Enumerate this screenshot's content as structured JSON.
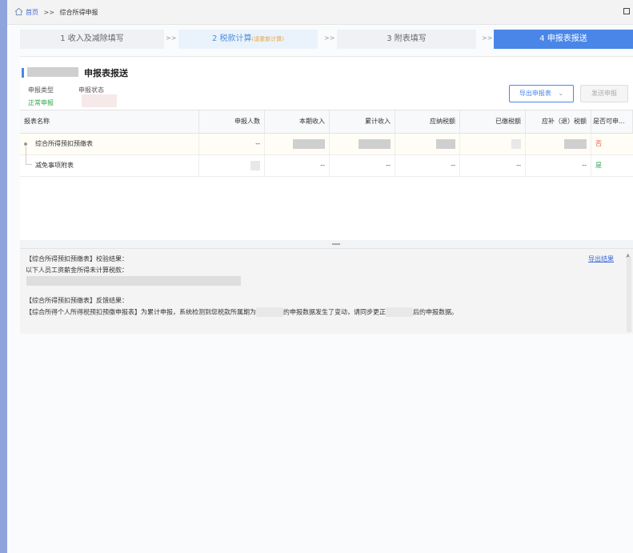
{
  "breadcrumb": {
    "home": "首页",
    "separator": ">>",
    "current": "综合所得申报"
  },
  "steps": [
    {
      "label": "1 收入及减除填写",
      "hint": ""
    },
    {
      "label": "2 税款计算",
      "hint": "(请重新计算)"
    },
    {
      "label": "3 附表填写",
      "hint": ""
    },
    {
      "label": "4 申报表报送",
      "hint": ""
    }
  ],
  "step_arrow": ">>",
  "panel": {
    "title": "申报表报送",
    "type_label": "申报类型",
    "type_value": "正常申报",
    "status_label": "申报状态",
    "export_button": "导出申报表",
    "send_button": "发送申报"
  },
  "table": {
    "headers": [
      "报表名称",
      "申报人数",
      "本期收入",
      "累计收入",
      "应纳税额",
      "已缴税额",
      "应补（退）税额",
      "是否可申..."
    ],
    "rows": [
      {
        "name": "综合所得预扣预缴表",
        "people": "--",
        "flag": "否"
      },
      {
        "name": "减免事项附表",
        "income": "--",
        "total": "--",
        "due": "--",
        "paid": "--",
        "refund": "--",
        "flag": "是"
      }
    ]
  },
  "results": {
    "line1": "【综合所得预扣预缴表】校验结果：",
    "line2": "以下人员工资薪金所得未计算税款：",
    "line3": "【综合所得预扣预缴表】反馈结果：",
    "line4a": "【综合所得个人所得税预扣预缴申报表】为累计申报，系统检测到您税款所属期为",
    "line4b": "的申报数据发生了变动，请同步更正",
    "line4c": "后的申报数据。",
    "export_link": "导出结果"
  },
  "colors": {
    "accent": "#4a86e8",
    "success": "#2aa64a",
    "danger": "#e05a4d",
    "warning": "#e7a33e"
  }
}
